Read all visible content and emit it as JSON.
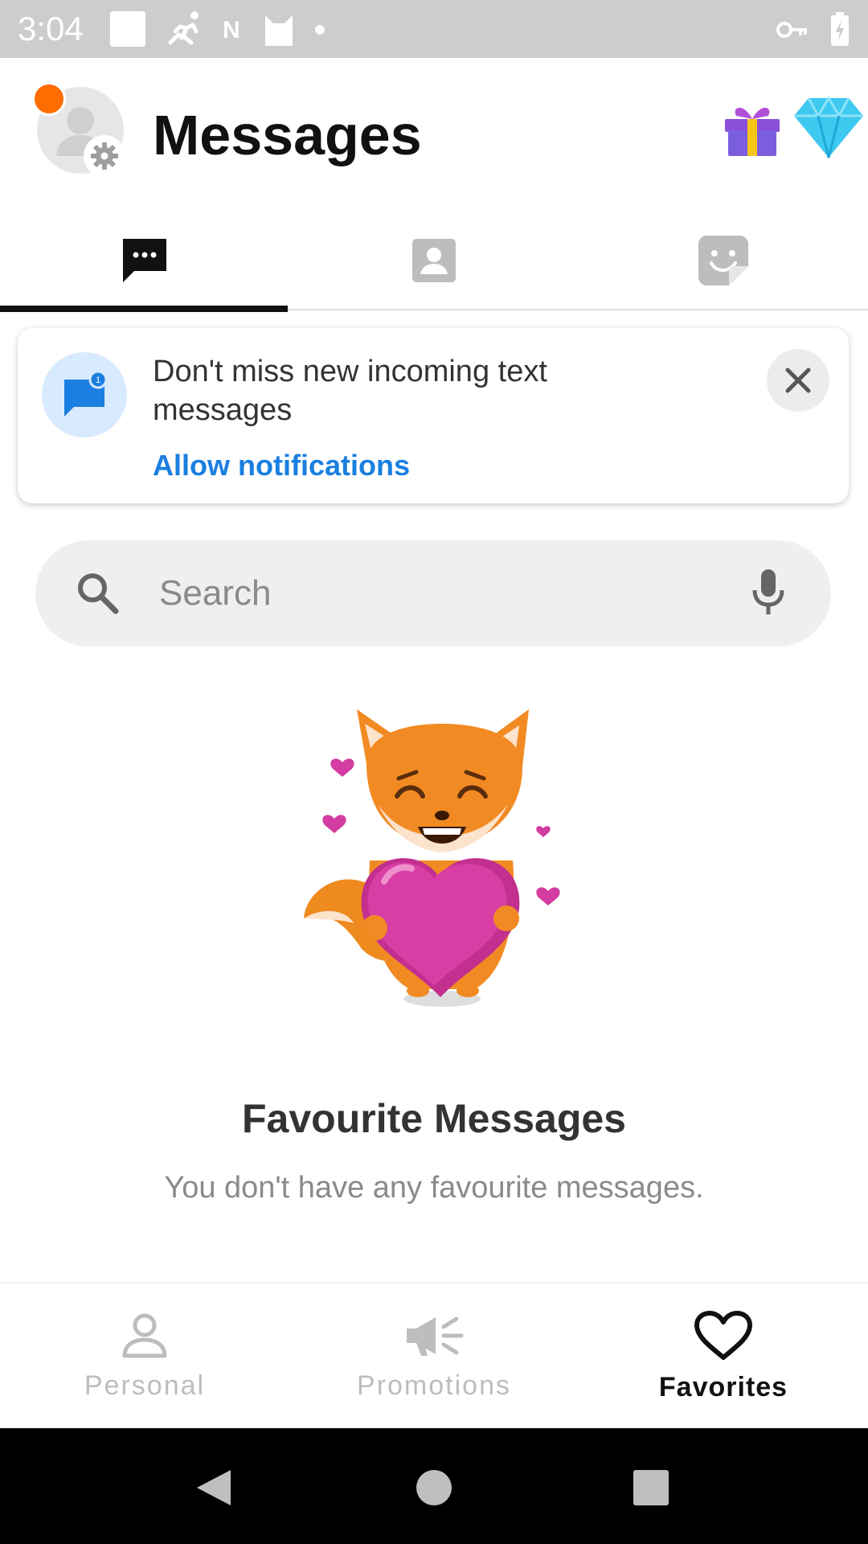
{
  "status_bar": {
    "time": "3:04",
    "icons_left": [
      "square-icon",
      "runner-icon",
      "n-icon",
      "cat-icon",
      "dot-icon"
    ],
    "icons_right": [
      "key-icon",
      "battery-charging-icon"
    ]
  },
  "header": {
    "title": "Messages",
    "notification_dot_color": "#ff6d00"
  },
  "top_tabs": [
    {
      "name": "chats",
      "icon": "chat-bubble-icon",
      "active": true
    },
    {
      "name": "contacts",
      "icon": "contact-card-icon",
      "active": false
    },
    {
      "name": "stickers",
      "icon": "sticker-icon",
      "active": false
    }
  ],
  "notification_card": {
    "text": "Don't miss new incoming text messages",
    "link": "Allow notifications",
    "badge": "1",
    "link_color": "#1a7fe0"
  },
  "search": {
    "placeholder": "Search"
  },
  "empty_state": {
    "title": "Favourite Messages",
    "text": "You don't have any favourite messages."
  },
  "bottom_nav": [
    {
      "label": "Personal",
      "icon": "person-icon",
      "active": false
    },
    {
      "label": "Promotions",
      "icon": "megaphone-icon",
      "active": false
    },
    {
      "label": "Favorites",
      "icon": "heart-icon",
      "active": true
    }
  ],
  "system_nav": [
    "back-icon",
    "home-icon",
    "recents-icon"
  ]
}
